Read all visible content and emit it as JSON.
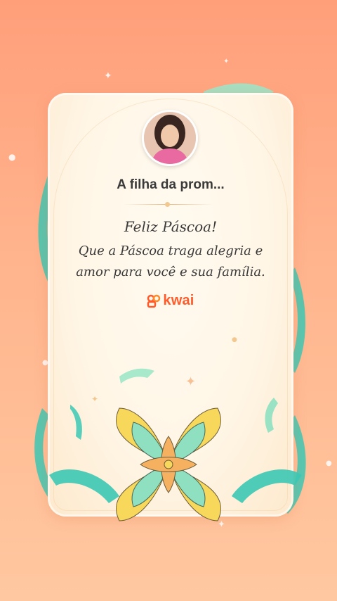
{
  "card": {
    "title": "A filha da prom...",
    "greeting": "Feliz Páscoa!",
    "message_line1": "Que a Páscoa traga alegria e",
    "message_line2": "amor para você e sua família.",
    "brand": "kwai"
  },
  "icons": [
    "avatar-photo",
    "kwai-logo-icon",
    "sparkle-icon",
    "flower-ornament",
    "ribbon-decoration"
  ],
  "colors": {
    "background_top": "#ff9f7a",
    "background_bottom": "#ffc8a0",
    "card": "#fff8ec",
    "text": "#3a3a3a",
    "brand": "#ff5a2a",
    "petal_yellow": "#f7d85a",
    "petal_green": "#8ee0c0",
    "petal_orange": "#f5b060",
    "ribbon_teal": "#3cc8b4"
  }
}
